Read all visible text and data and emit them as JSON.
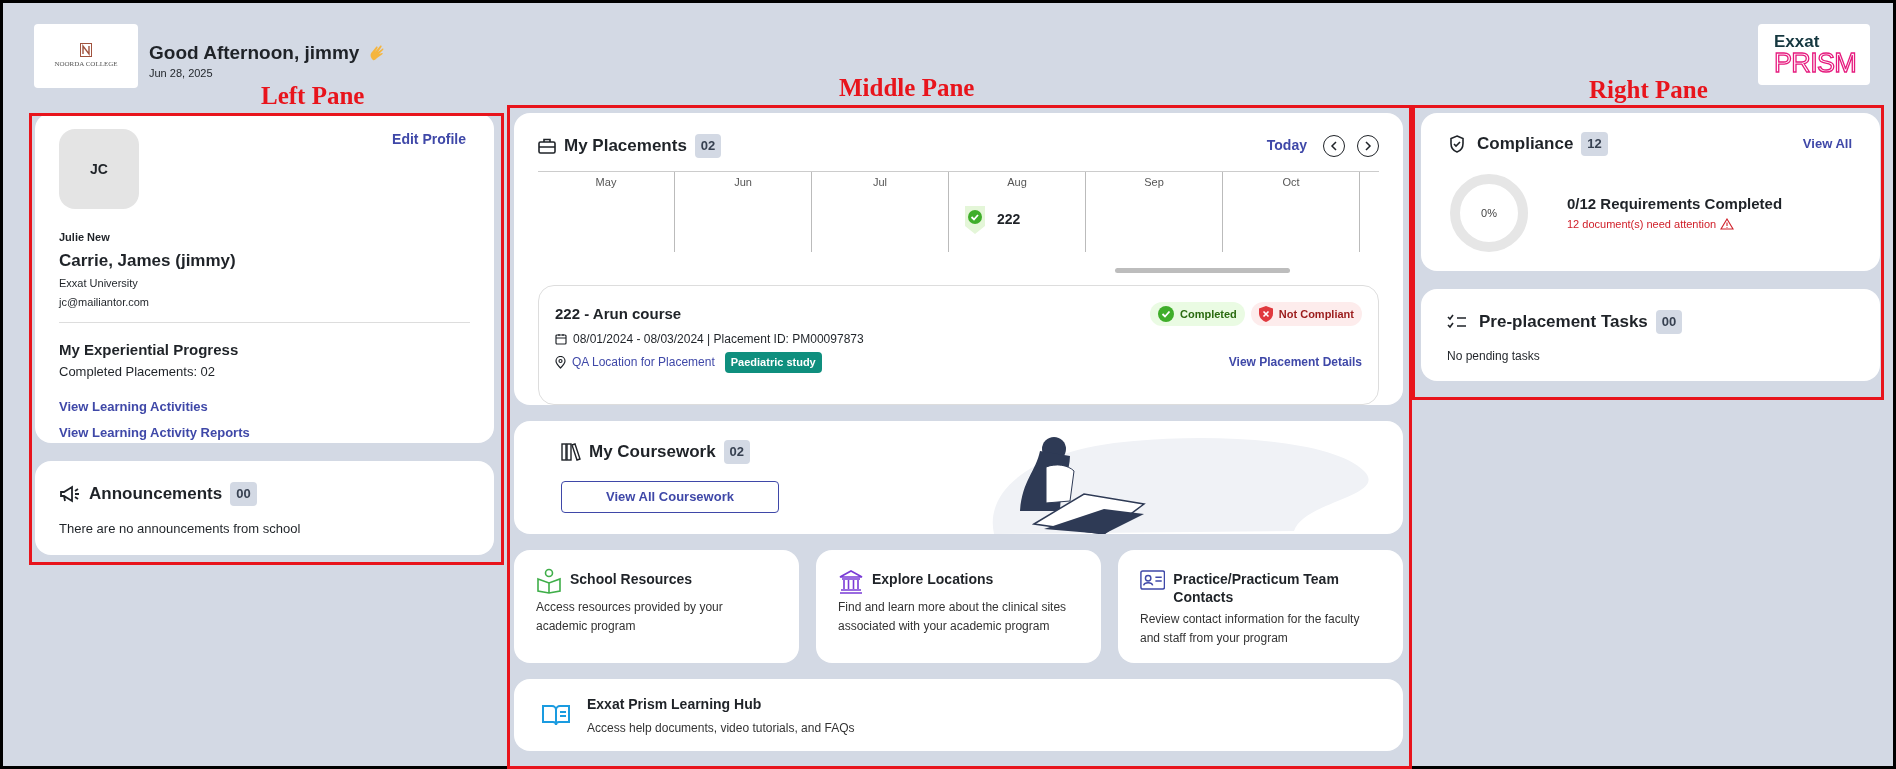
{
  "annotations": [
    {
      "label": "Left Pane"
    },
    {
      "label": "Middle Pane"
    },
    {
      "label": "Right Pane"
    }
  ],
  "header": {
    "school_logo": {
      "name": "NOORDA COLLEGE"
    },
    "greeting": "Good Afternoon, jimmy",
    "date": "Jun 28, 2025",
    "brand_logo": {
      "top": "Exxat",
      "bottom": "PRISM"
    }
  },
  "profile": {
    "initials": "JC",
    "edit_link": "Edit Profile",
    "preferred_name": "Julie New",
    "full_name": "Carrie, James (jimmy)",
    "university": "Exxat University",
    "email": "jc@mailiantor.com",
    "progress_title": "My Experiential Progress",
    "completed": "Completed Placements: 02",
    "links": [
      "View Learning Activities",
      "View Learning Activity Reports"
    ]
  },
  "announcements": {
    "title": "Announcements",
    "count": "00",
    "empty_text": "There are no announcements from school"
  },
  "placements": {
    "title": "My Placements",
    "count": "02",
    "today": "Today",
    "months": [
      {
        "label": "May"
      },
      {
        "label": "Jun"
      },
      {
        "label": "Jul"
      },
      {
        "label": "Aug",
        "markers": [
          {
            "label": "222",
            "kind": "completed"
          }
        ]
      },
      {
        "label": "Sep"
      },
      {
        "label": "Oct"
      }
    ],
    "detail": {
      "title": "222 - Arun course",
      "dates": "08/01/2024 - 08/03/2024 | Placement ID: PM00097873",
      "location": "QA Location for Placement",
      "tag": "Paediatric study",
      "badges": [
        {
          "label": "Completed",
          "kind": "success"
        },
        {
          "label": "Not Compliant",
          "kind": "danger"
        }
      ],
      "details_link": "View Placement Details"
    }
  },
  "coursework": {
    "title": "My Coursework",
    "count": "02",
    "button": "View All Coursework"
  },
  "resources": [
    {
      "kind": "school",
      "title": "School Resources",
      "description": "Access resources provided by your academic program"
    },
    {
      "kind": "locations",
      "title": "Explore Locations",
      "description": "Find and learn more about the clinical sites associated with your academic program"
    },
    {
      "kind": "contacts",
      "title": "Practice/Practicum Team Contacts",
      "description": "Review contact information for the faculty and staff from your program"
    }
  ],
  "learning_hub": {
    "title": "Exxat Prism Learning Hub",
    "description": "Access help documents, video tutorials, and FAQs"
  },
  "compliance": {
    "title": "Compliance",
    "count": "12",
    "view_all": "View All",
    "level": 0,
    "percent": "0%",
    "summary": "0/12 Requirements Completed",
    "attention": "12 document(s) need attention"
  },
  "tasks": {
    "title": "Pre-placement Tasks",
    "count": "00",
    "empty_text": "No pending tasks"
  }
}
